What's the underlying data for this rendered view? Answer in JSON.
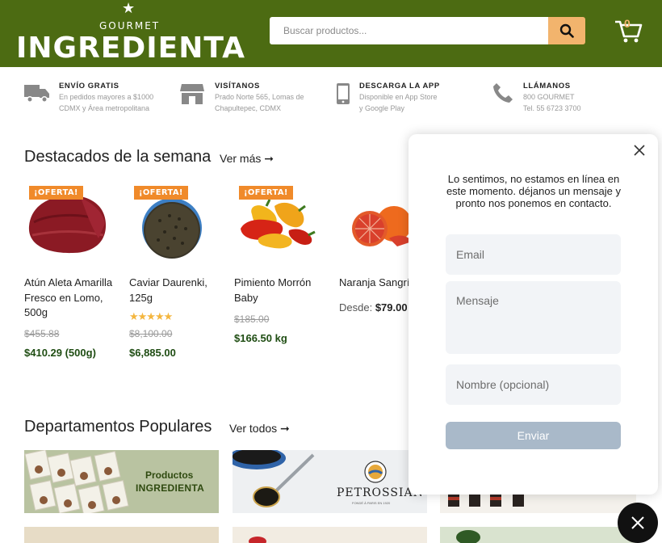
{
  "header": {
    "logo_small": "GOURMET",
    "logo_big": "INGREDIENTA",
    "search_placeholder": "Buscar productos...",
    "cart_count": "0"
  },
  "info": [
    {
      "title": "ENVÍO GRATIS",
      "line1": "En pedidos mayores a $1000",
      "line2": "CDMX y Área metropolitana",
      "icon": "truck-icon"
    },
    {
      "title": "VISÍTANOS",
      "line1": "Prado Norte 565, Lomas de",
      "line2": "Chapultepec, CDMX",
      "icon": "store-icon"
    },
    {
      "title": "DESCARGA LA APP",
      "line1": "Disponible en App Store",
      "line2": "y Google Play",
      "icon": "phone-icon"
    },
    {
      "title": "LLÁMANOS",
      "line1": "800 GOURMET",
      "line2": "Tel. 55 6723 3700",
      "icon": "call-icon"
    }
  ],
  "featured": {
    "title": "Destacados de la semana",
    "link": "Ver más ➞",
    "products": [
      {
        "badge": "¡OFERTA!",
        "name": "Atún Aleta Amarilla Fresco en Lomo, 500g",
        "old_price": "$455.88",
        "price": "$410.29 (500g)"
      },
      {
        "badge": "¡OFERTA!",
        "name": "Caviar Daurenki, 125g",
        "stars": "★★★★★",
        "rating": 5,
        "old_price": "$8,100.00",
        "price": "$6,885.00"
      },
      {
        "badge": "¡OFERTA!",
        "name": "Pimiento Morrón Baby",
        "old_price": "$185.00",
        "price": "$166.50 kg"
      },
      {
        "name": "Naranja Sangrí",
        "from_label": "Desde:",
        "from_price": "$79.00"
      }
    ]
  },
  "departments": {
    "title": "Departamentos Populares",
    "link": "Ver todos ➞",
    "banner1_line1": "Productos",
    "banner1_line2": "INGREDIENTA",
    "banner2_brand": "PETROSSIAN",
    "banner2_sub": "FONDÉ À PARIS EN 1920"
  },
  "chat": {
    "message": "Lo sentimos, no estamos en línea en este momento. déjanos un mensaje y pronto nos ponemos en contacto.",
    "email_placeholder": "Email",
    "message_placeholder": "Mensaje",
    "name_placeholder": "Nombre (opcional)",
    "send_label": "Enviar"
  },
  "colors": {
    "header": "#4c6b12",
    "accent": "#f2b46d",
    "badge": "#f08a2a",
    "price": "#1f4d13"
  }
}
